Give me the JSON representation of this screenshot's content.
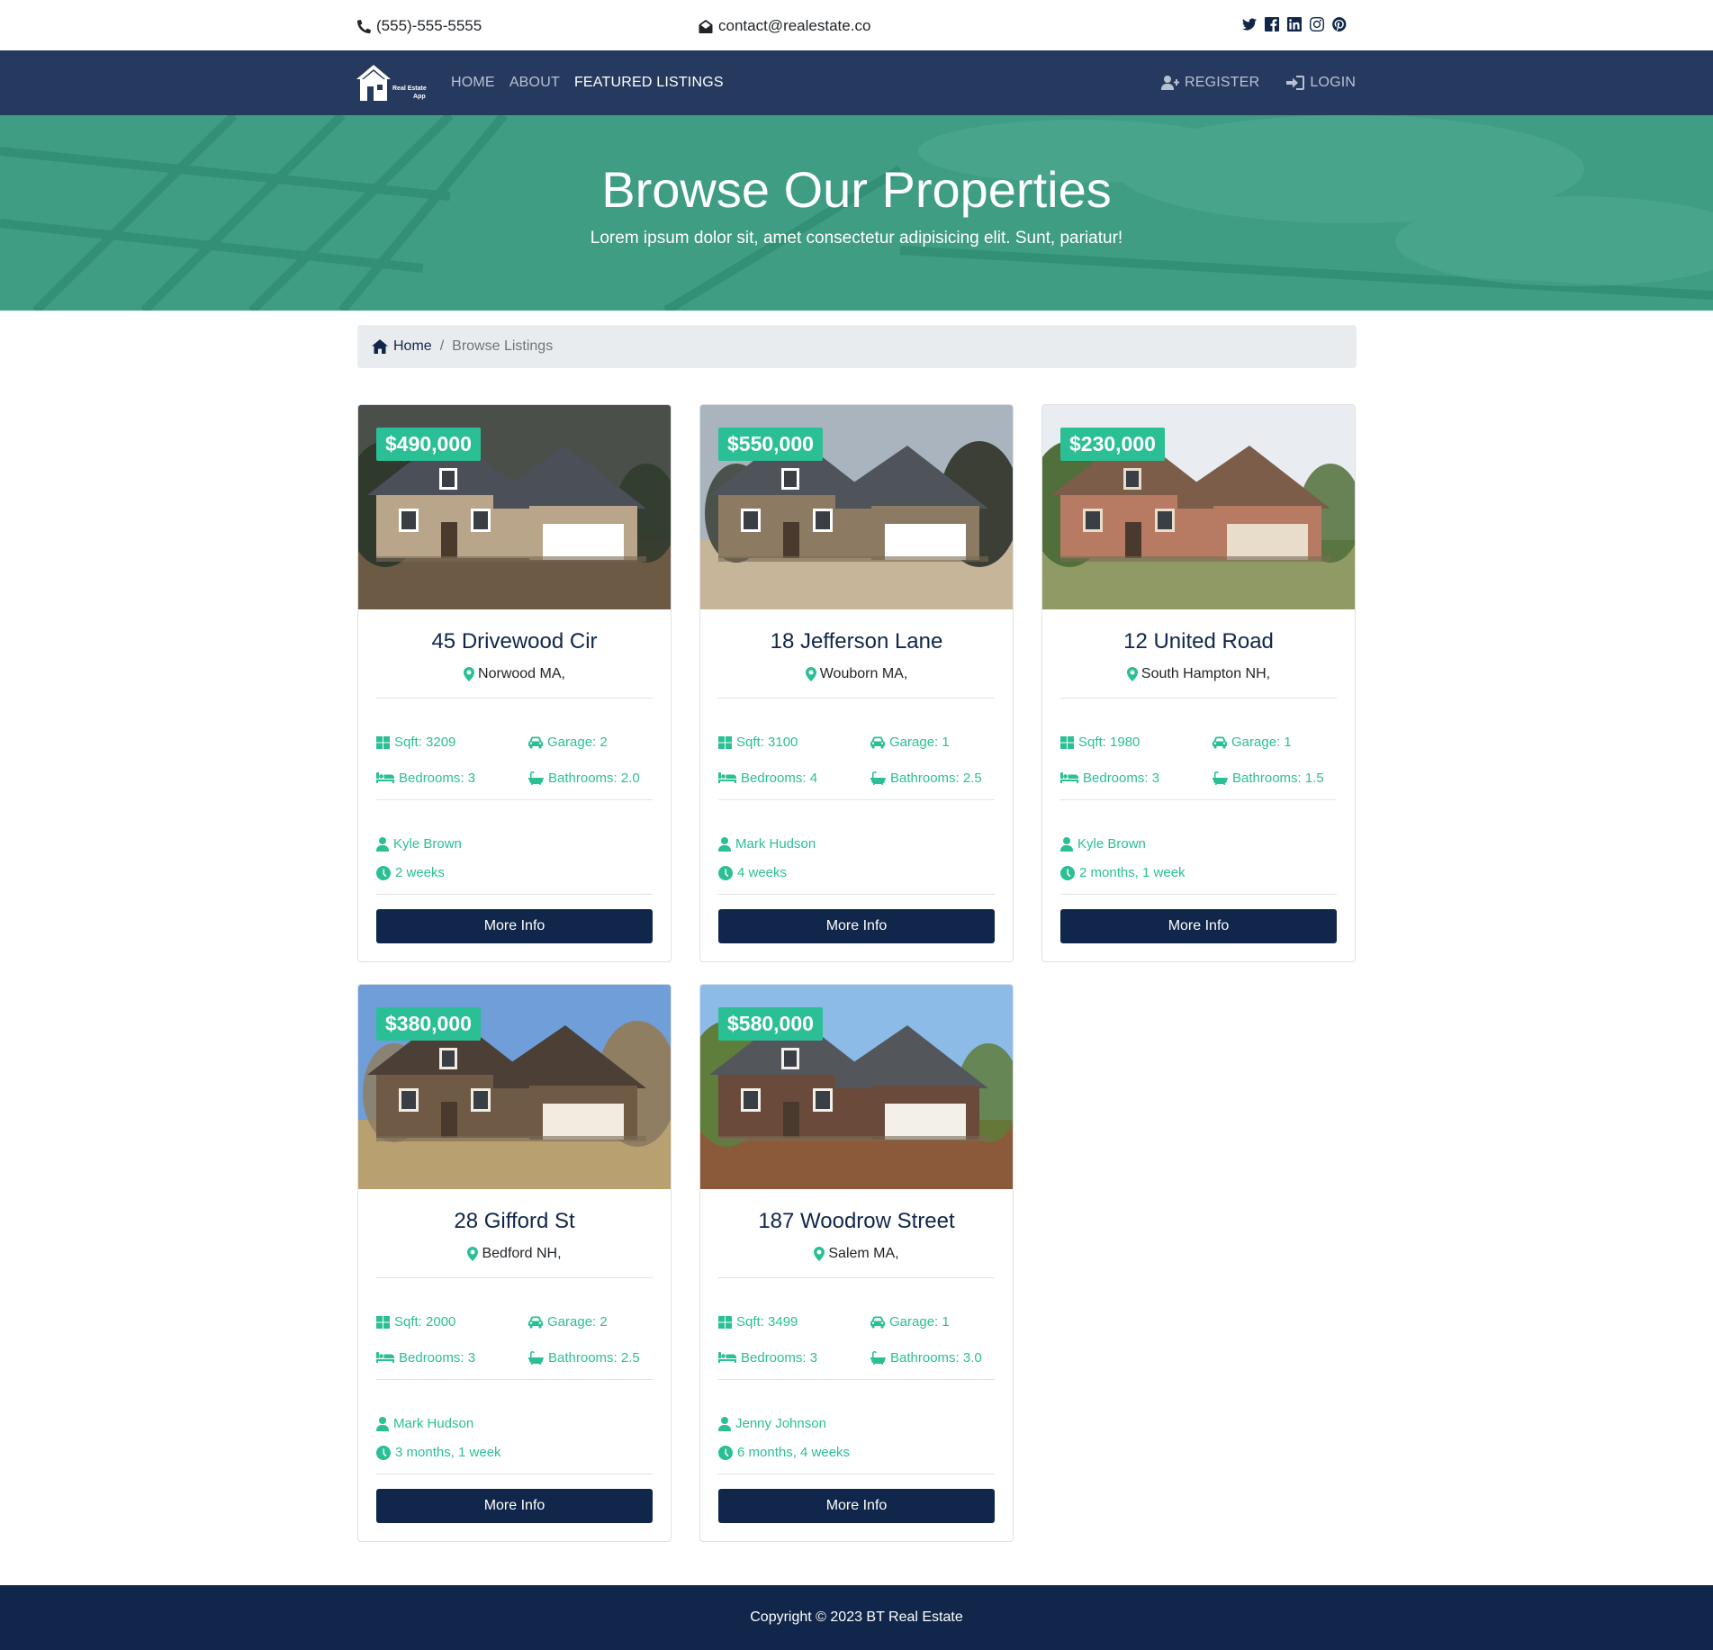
{
  "topbar": {
    "phone": "(555)-555-5555",
    "email": "contact@realestate.co",
    "socials": [
      "twitter-icon",
      "facebook-icon",
      "linkedin-icon",
      "instagram-icon",
      "pinterest-icon"
    ]
  },
  "nav": {
    "brand_line1": "Real Estate",
    "brand_line2": "App",
    "links": [
      {
        "label": "HOME"
      },
      {
        "label": "ABOUT"
      },
      {
        "label": "FEATURED LISTINGS"
      }
    ],
    "register": "REGISTER",
    "login": "LOGIN"
  },
  "hero": {
    "title": "Browse Our Properties",
    "subtitle": "Lorem ipsum dolor sit, amet consectetur adipisicing elit. Sunt, pariatur!"
  },
  "breadcrumb": {
    "home": "Home",
    "current": "Browse Listings"
  },
  "listings": [
    {
      "price": "$490,000",
      "title": "45 Drivewood Cir",
      "location": "Norwood MA,",
      "sqft": "Sqft: 3209",
      "garage": "Garage: 2",
      "bedrooms": "Bedrooms: 3",
      "bathrooms": "Bathrooms: 2.0",
      "realtor": "Kyle Brown",
      "listed": "2 weeks",
      "button": "More Info"
    },
    {
      "price": "$550,000",
      "title": "18 Jefferson Lane",
      "location": "Wouborn MA,",
      "sqft": "Sqft: 3100",
      "garage": "Garage: 1",
      "bedrooms": "Bedrooms: 4",
      "bathrooms": "Bathrooms: 2.5",
      "realtor": "Mark Hudson",
      "listed": "4 weeks",
      "button": "More Info"
    },
    {
      "price": "$230,000",
      "title": "12 United Road",
      "location": "South Hampton NH,",
      "sqft": "Sqft: 1980",
      "garage": "Garage: 1",
      "bedrooms": "Bedrooms: 3",
      "bathrooms": "Bathrooms: 1.5",
      "realtor": "Kyle Brown",
      "listed": "2 months, 1 week",
      "button": "More Info"
    },
    {
      "price": "$380,000",
      "title": "28 Gifford St",
      "location": "Bedford NH,",
      "sqft": "Sqft: 2000",
      "garage": "Garage: 2",
      "bedrooms": "Bedrooms: 3",
      "bathrooms": "Bathrooms: 2.5",
      "realtor": "Mark Hudson",
      "listed": "3 months, 1 week",
      "button": "More Info"
    },
    {
      "price": "$580,000",
      "title": "187 Woodrow Street",
      "location": "Salem MA,",
      "sqft": "Sqft: 3499",
      "garage": "Garage: 1",
      "bedrooms": "Bedrooms: 3",
      "bathrooms": "Bathrooms: 3.0",
      "realtor": "Jenny Johnson",
      "listed": "6 months, 4 weeks",
      "button": "More Info"
    }
  ],
  "footer": {
    "copyright": "Copyright © 2023 BT Real Estate"
  },
  "colors": {
    "navy": "#10264a",
    "nav_bg": "#263a60",
    "accent": "#2bbf95",
    "hero": "#3f9d84"
  }
}
